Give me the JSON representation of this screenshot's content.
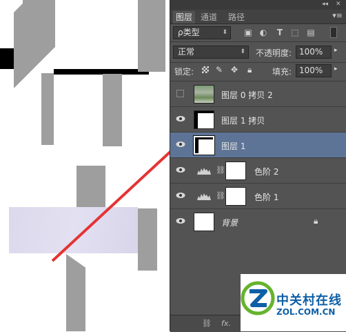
{
  "panel": {
    "tabs": [
      {
        "label": "图层"
      },
      {
        "label": "通道"
      },
      {
        "label": "路径"
      }
    ],
    "filter": {
      "label": "ρ类型"
    },
    "blend_mode": "正常",
    "opacity_label": "不透明度:",
    "opacity_value": "100%",
    "lock_label": "锁定:",
    "fill_label": "填充:",
    "fill_value": "100%",
    "layers": [
      {
        "name": "图层 0 拷贝 2",
        "visible": false,
        "selected": false
      },
      {
        "name": "图层 1 拷贝",
        "visible": true,
        "selected": false
      },
      {
        "name": "图层 1",
        "visible": true,
        "selected": true
      },
      {
        "name": "色阶 2",
        "visible": true,
        "selected": false
      },
      {
        "name": "色阶 1",
        "visible": true,
        "selected": false
      },
      {
        "name": "背景",
        "visible": true,
        "selected": false
      }
    ],
    "bottom_icons": [
      "link-icon",
      "fx-icon"
    ],
    "bottom_fx": "fx."
  },
  "watermark": {
    "line1": "中关村在线",
    "line2": "ZOL.COM.CN"
  },
  "colors": {
    "panel_bg": "#535353",
    "selected_layer": "#5d7496",
    "arrow": "#e53333",
    "logo_blue": "#0d5fa6",
    "logo_green": "#66b32e"
  }
}
